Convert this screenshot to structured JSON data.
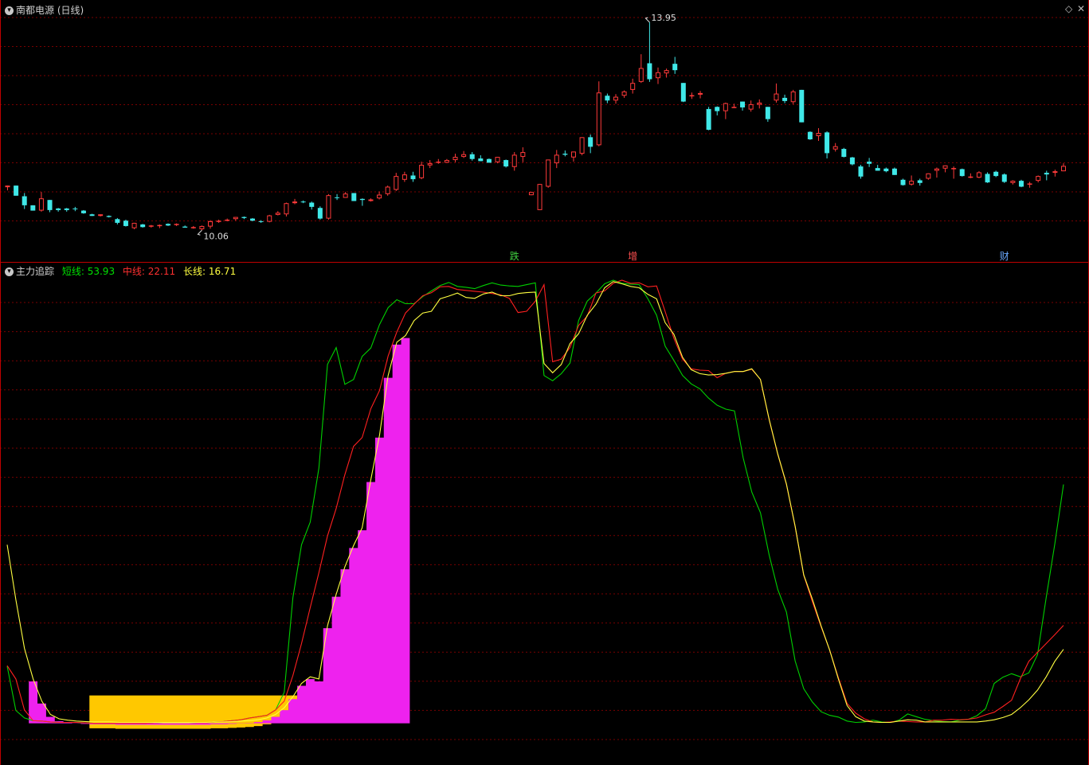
{
  "top": {
    "title": "南都电源 (日线)",
    "high_label": "13.95",
    "low_label": "10.06",
    "event_markers": [
      {
        "label": "跌",
        "color": "#40d040"
      },
      {
        "label": "增",
        "color": "#ff5050"
      },
      {
        "label": "财",
        "color": "#6aa8ff"
      }
    ]
  },
  "bottom": {
    "title": "主力追踪",
    "legend": [
      {
        "name": "短线",
        "value": "53.93",
        "color": "#00e000"
      },
      {
        "name": "中线",
        "value": "22.11",
        "color": "#ff3030"
      },
      {
        "name": "长线",
        "value": "16.71",
        "color": "#ffff40"
      }
    ]
  },
  "colors": {
    "up": "#ff3a3a",
    "down": "#40e8e8",
    "grid": "#7a0000",
    "gold_fill": "#ffc800",
    "magenta_fill": "#ee22ee"
  },
  "chart_data": [
    {
      "type": "candlestick",
      "title": "南都电源 (日线)",
      "ylim": [
        9.7,
        14.1
      ],
      "candles": [
        [
          10.85,
          10.88,
          10.79,
          10.88
        ],
        [
          10.88,
          10.88,
          10.69,
          10.69
        ],
        [
          10.68,
          10.74,
          10.44,
          10.51
        ],
        [
          10.51,
          10.51,
          10.41,
          10.41
        ],
        [
          10.41,
          10.76,
          10.39,
          10.64
        ],
        [
          10.61,
          10.61,
          10.38,
          10.42
        ],
        [
          10.45,
          10.46,
          10.39,
          10.42
        ],
        [
          10.45,
          10.46,
          10.39,
          10.42
        ],
        [
          10.45,
          10.48,
          10.4,
          10.44
        ],
        [
          10.41,
          10.42,
          10.35,
          10.36
        ],
        [
          10.34,
          10.35,
          10.31,
          10.31
        ],
        [
          10.31,
          10.34,
          10.3,
          10.34
        ],
        [
          10.31,
          10.32,
          10.28,
          10.29
        ],
        [
          10.25,
          10.27,
          10.15,
          10.18
        ],
        [
          10.22,
          10.24,
          10.11,
          10.12
        ],
        [
          10.08,
          10.18,
          10.06,
          10.18
        ],
        [
          10.15,
          10.16,
          10.09,
          10.1
        ],
        [
          10.13,
          10.14,
          10.09,
          10.13
        ],
        [
          10.12,
          10.15,
          10.08,
          10.14
        ],
        [
          10.16,
          10.17,
          10.12,
          10.13
        ],
        [
          10.15,
          10.17,
          10.12,
          10.16
        ],
        [
          10.11,
          10.13,
          10.09,
          10.09
        ],
        [
          10.1,
          10.12,
          10.07,
          10.1
        ],
        [
          10.06,
          10.13,
          10.04,
          10.12
        ],
        [
          10.11,
          10.23,
          10.07,
          10.21
        ],
        [
          10.22,
          10.24,
          10.18,
          10.22
        ],
        [
          10.22,
          10.26,
          10.21,
          10.24
        ],
        [
          10.25,
          10.29,
          10.22,
          10.29
        ],
        [
          10.29,
          10.3,
          10.25,
          10.27
        ],
        [
          10.26,
          10.27,
          10.21,
          10.22
        ],
        [
          10.21,
          10.23,
          10.18,
          10.2
        ],
        [
          10.2,
          10.33,
          10.19,
          10.32
        ],
        [
          10.33,
          10.4,
          10.32,
          10.37
        ],
        [
          10.34,
          10.56,
          10.3,
          10.55
        ],
        [
          10.55,
          10.63,
          10.53,
          10.58
        ],
        [
          10.58,
          10.6,
          10.55,
          10.57
        ],
        [
          10.56,
          10.58,
          10.43,
          10.48
        ],
        [
          10.46,
          10.49,
          10.24,
          10.26
        ],
        [
          10.26,
          10.72,
          10.24,
          10.7
        ],
        [
          10.66,
          10.72,
          10.61,
          10.65
        ],
        [
          10.65,
          10.76,
          10.65,
          10.73
        ],
        [
          10.74,
          10.74,
          10.59,
          10.59
        ],
        [
          10.63,
          10.64,
          10.5,
          10.61
        ],
        [
          10.59,
          10.64,
          10.58,
          10.62
        ],
        [
          10.64,
          10.77,
          10.62,
          10.71
        ],
        [
          10.72,
          10.88,
          10.69,
          10.86
        ],
        [
          10.8,
          11.12,
          10.78,
          11.06
        ],
        [
          10.99,
          11.14,
          10.95,
          11.09
        ],
        [
          11.07,
          11.14,
          10.95,
          11.0
        ],
        [
          11.02,
          11.33,
          11.0,
          11.27
        ],
        [
          11.26,
          11.36,
          11.21,
          11.3
        ],
        [
          11.33,
          11.38,
          11.29,
          11.33
        ],
        [
          11.31,
          11.38,
          11.31,
          11.36
        ],
        [
          11.36,
          11.48,
          11.32,
          11.42
        ],
        [
          11.42,
          11.53,
          11.4,
          11.47
        ],
        [
          11.47,
          11.51,
          11.35,
          11.38
        ],
        [
          11.39,
          11.45,
          11.34,
          11.34
        ],
        [
          11.38,
          11.39,
          11.31,
          11.31
        ],
        [
          11.32,
          11.42,
          11.3,
          11.42
        ],
        [
          11.36,
          11.37,
          11.22,
          11.24
        ],
        [
          11.23,
          11.51,
          11.16,
          11.46
        ],
        [
          11.42,
          11.6,
          11.32,
          11.51
        ],
        [
          10.7,
          10.76,
          10.7,
          10.76
        ],
        [
          10.42,
          10.91,
          10.42,
          10.91
        ],
        [
          10.86,
          11.37,
          10.84,
          11.37
        ],
        [
          11.3,
          11.55,
          11.21,
          11.46
        ],
        [
          11.48,
          11.54,
          11.43,
          11.46
        ],
        [
          11.41,
          11.52,
          11.33,
          11.52
        ],
        [
          11.48,
          11.79,
          11.45,
          11.79
        ],
        [
          11.79,
          11.84,
          11.49,
          11.61
        ],
        [
          11.64,
          12.84,
          11.62,
          12.63
        ],
        [
          12.57,
          12.61,
          12.43,
          12.48
        ],
        [
          12.48,
          12.6,
          12.42,
          12.55
        ],
        [
          12.57,
          12.67,
          12.53,
          12.65
        ],
        [
          12.68,
          12.89,
          12.61,
          12.81
        ],
        [
          12.83,
          13.35,
          12.81,
          13.09
        ],
        [
          13.18,
          13.95,
          12.83,
          12.88
        ],
        [
          12.9,
          13.1,
          12.79,
          13.01
        ],
        [
          12.99,
          13.08,
          12.91,
          13.05
        ],
        [
          13.17,
          13.3,
          12.98,
          13.05
        ],
        [
          12.81,
          12.81,
          12.45,
          12.46
        ],
        [
          12.57,
          12.63,
          12.51,
          12.58
        ],
        [
          12.59,
          12.66,
          12.52,
          12.62
        ],
        [
          12.32,
          12.36,
          11.92,
          11.93
        ],
        [
          12.36,
          12.37,
          12.2,
          12.28
        ],
        [
          12.28,
          12.44,
          12.13,
          12.43
        ],
        [
          12.36,
          12.42,
          12.34,
          12.36
        ],
        [
          12.46,
          12.46,
          12.29,
          12.35
        ],
        [
          12.31,
          12.48,
          12.27,
          12.41
        ],
        [
          12.4,
          12.5,
          12.33,
          12.44
        ],
        [
          12.36,
          12.36,
          12.08,
          12.13
        ],
        [
          12.48,
          12.8,
          12.44,
          12.61
        ],
        [
          12.53,
          12.59,
          12.43,
          12.47
        ],
        [
          12.45,
          12.68,
          12.41,
          12.65
        ],
        [
          12.68,
          12.68,
          12.07,
          12.07
        ],
        [
          11.89,
          11.9,
          11.74,
          11.75
        ],
        [
          11.81,
          11.96,
          11.72,
          11.87
        ],
        [
          11.88,
          11.9,
          11.39,
          11.49
        ],
        [
          11.56,
          11.68,
          11.52,
          11.62
        ],
        [
          11.57,
          11.59,
          11.41,
          11.42
        ],
        [
          11.41,
          11.42,
          11.26,
          11.28
        ],
        [
          11.24,
          11.27,
          11.01,
          11.05
        ],
        [
          11.33,
          11.4,
          11.23,
          11.29
        ],
        [
          11.21,
          11.27,
          11.16,
          11.16
        ],
        [
          11.2,
          11.22,
          11.13,
          11.15
        ],
        [
          11.2,
          11.22,
          11.08,
          11.08
        ],
        [
          10.99,
          11.01,
          10.88,
          10.89
        ],
        [
          10.9,
          11.07,
          10.88,
          10.97
        ],
        [
          10.98,
          11.01,
          10.88,
          10.93
        ],
        [
          11.01,
          11.11,
          10.99,
          11.11
        ],
        [
          11.16,
          11.22,
          11.03,
          11.2
        ],
        [
          11.2,
          11.26,
          11.13,
          11.26
        ],
        [
          11.21,
          11.24,
          11.01,
          11.21
        ],
        [
          11.19,
          11.2,
          11.05,
          11.06
        ],
        [
          11.03,
          11.11,
          11.02,
          11.05
        ],
        [
          11.03,
          11.15,
          11.02,
          11.13
        ],
        [
          11.1,
          11.13,
          10.93,
          10.94
        ],
        [
          11.14,
          11.16,
          11.04,
          11.06
        ],
        [
          11.09,
          11.11,
          10.93,
          10.95
        ],
        [
          10.93,
          10.98,
          10.9,
          10.97
        ],
        [
          10.97,
          10.99,
          10.85,
          10.86
        ],
        [
          10.92,
          10.95,
          10.84,
          10.92
        ],
        [
          10.97,
          11.07,
          10.94,
          11.06
        ],
        [
          11.12,
          11.16,
          10.98,
          11.09
        ],
        [
          11.12,
          11.18,
          11.05,
          11.15
        ],
        [
          11.15,
          11.3,
          11.15,
          11.25
        ]
      ]
    },
    {
      "type": "line",
      "title": "主力追踪",
      "ylim": [
        -6,
        100
      ],
      "series": [
        {
          "name": "短线",
          "values": [
            12.9,
            2.9,
            1.2,
            0.6,
            0.5,
            0.3,
            0.2,
            0.2,
            0.2,
            0.1,
            0.0,
            0.0,
            0.0,
            0.0,
            0.0,
            0.0,
            0.0,
            0.1,
            0.2,
            0.2,
            0.2,
            0.2,
            0.1,
            0.1,
            0.3,
            0.4,
            0.6,
            0.8,
            1.2,
            1.5,
            1.8,
            3.0,
            7.0,
            28.4,
            40.3,
            45.4,
            57.6,
            81.0,
            84.8,
            76.5,
            77.6,
            82.8,
            84.7,
            90.0,
            93.8,
            95.6,
            94.7,
            94.7,
            96.3,
            97.6,
            98.8,
            99.5,
            98.6,
            98.4,
            98.1,
            98.8,
            99.4,
            98.9,
            98.7,
            98.6,
            99.0,
            99.4,
            78.5,
            77.3,
            78.9,
            81.3,
            90.9,
            95.3,
            97.1,
            99.2,
            100.0,
            99.3,
            99.1,
            99.0,
            95.8,
            92.1,
            85.1,
            81.9,
            78.5,
            76.6,
            75.5,
            73.4,
            71.8,
            70.9,
            70.5,
            59.9,
            52.2,
            47.5,
            38.0,
            30.2,
            25.1,
            14.1,
            7.8,
            4.8,
            2.6,
            1.8,
            1.4,
            0.5,
            0.2,
            0.3,
            0.7,
            0.3,
            0.2,
            0.7,
            2.1,
            1.5,
            0.9,
            0.6,
            0.4,
            0.3,
            0.7,
            0.9,
            1.7,
            3.3,
            9.0,
            10.4,
            11.2,
            10.5,
            11.4,
            15.5,
            28.4,
            40.5,
            53.9
          ]
        },
        {
          "name": "中线",
          "values": [
            13.0,
            10.0,
            3.0,
            0.6,
            0.5,
            0.3,
            0.2,
            0.2,
            0.2,
            0.1,
            0.0,
            0.0,
            0.0,
            0.0,
            0.0,
            0.0,
            0.0,
            0.1,
            0.2,
            0.2,
            0.2,
            0.2,
            0.1,
            0.1,
            0.3,
            0.4,
            0.6,
            0.8,
            1.2,
            1.5,
            1.8,
            3.0,
            5.0,
            10.8,
            18.0,
            26.1,
            34.0,
            42.3,
            48.5,
            56.1,
            62.5,
            64.5,
            71.0,
            75.1,
            82.9,
            88.3,
            92.6,
            94.6,
            96.5,
            97.2,
            98.5,
            98.6,
            97.9,
            97.7,
            97.5,
            97.3,
            97.0,
            96.7,
            95.9,
            92.7,
            93.0,
            95.3,
            99.0,
            81.6,
            82.2,
            84.8,
            89.8,
            91.9,
            97.1,
            97.6,
            99.3,
            100.0,
            99.3,
            99.4,
            98.5,
            98.7,
            92.9,
            86.9,
            82.2,
            80.0,
            79.7,
            79.6,
            78.0,
            79.0,
            79.4,
            79.4,
            79.9,
            77.6,
            68.5,
            60.7,
            53.9,
            44.4,
            33.4,
            27.4,
            21.8,
            16.5,
            10.3,
            4.5,
            2.3,
            1.0,
            0.3,
            0.2,
            0.3,
            0.5,
            0.4,
            0.3,
            0.3,
            0.7,
            0.7,
            0.9,
            0.8,
            0.9,
            1.2,
            1.9,
            2.5,
            3.8,
            5.2,
            10.0,
            14.0,
            16.0,
            18.0,
            20.0,
            22.1
          ]
        },
        {
          "name": "长线",
          "values": [
            40.3,
            27.9,
            16.9,
            10.0,
            5.0,
            2.0,
            1.0,
            0.7,
            0.5,
            0.4,
            0.3,
            0.3,
            0.3,
            0.2,
            0.2,
            0.2,
            0.2,
            0.2,
            0.2,
            0.2,
            0.2,
            0.2,
            0.2,
            0.2,
            0.3,
            0.3,
            0.4,
            0.5,
            0.6,
            0.8,
            1.2,
            2.0,
            3.5,
            6.0,
            9.0,
            10.5,
            10.0,
            22.0,
            29.1,
            35.3,
            40.1,
            44.1,
            55.0,
            65.0,
            78.5,
            86.0,
            87.5,
            90.9,
            92.6,
            93.0,
            95.8,
            96.4,
            97.1,
            96.1,
            95.9,
            96.9,
            97.3,
            96.5,
            96.5,
            97.0,
            97.2,
            97.3,
            81.2,
            79.1,
            81.0,
            85.7,
            87.9,
            92.1,
            94.6,
            98.3,
            99.7,
            99.2,
            98.6,
            98.3,
            96.8,
            95.8,
            90.4,
            87.8,
            82.6,
            79.8,
            78.9,
            78.6,
            78.7,
            79.0,
            79.4,
            79.4,
            80.0,
            77.6,
            68.6,
            60.8,
            54.0,
            44.5,
            33.5,
            28.0,
            22.0,
            16.5,
            10.0,
            4.0,
            1.5,
            0.5,
            0.3,
            0.2,
            0.2,
            0.5,
            0.8,
            0.7,
            0.3,
            0.3,
            0.3,
            0.3,
            0.3,
            0.3,
            0.3,
            0.5,
            0.8,
            1.3,
            2.0,
            3.5,
            5.3,
            7.5,
            10.5,
            14.0,
            16.7
          ]
        }
      ],
      "gold_area_segments": [
        [
          10,
          44
        ],
        [
          159,
          181
        ]
      ],
      "magenta_area_segments": [
        [
          3,
          46
        ],
        [
          163,
          189
        ]
      ]
    }
  ]
}
